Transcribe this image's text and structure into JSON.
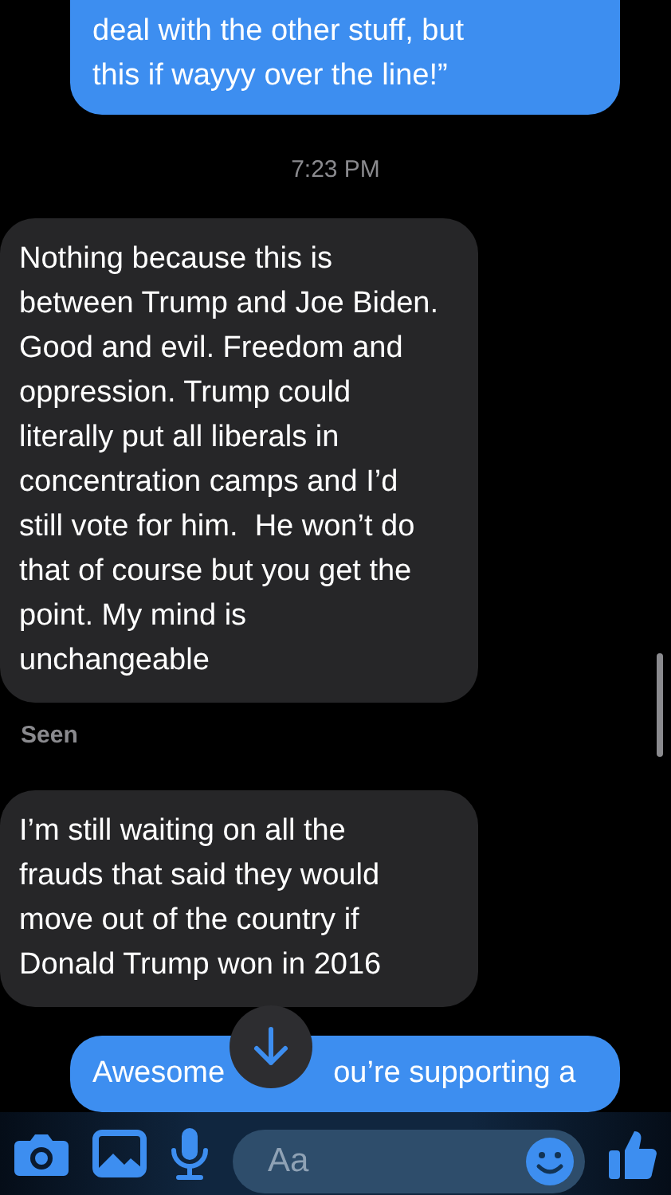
{
  "messages": [
    {
      "kind": "sent",
      "text": "deal with the other stuff, but\nthis if wayyy over the line!”"
    },
    {
      "kind": "time",
      "text": "7:23 PM"
    },
    {
      "kind": "received",
      "text": "Nothing because this is\nbetween Trump and Joe Biden.\nGood and evil. Freedom and\noppression. Trump could\nliterally put all liberals in\nconcentration camps and I’d\nstill vote for him.  He won’t do\nthat of course but you get the\npoint. My mind is\nunchangeable"
    },
    {
      "kind": "status",
      "text": "Seen"
    },
    {
      "kind": "received",
      "text": "I’m still waiting on all the\nfrauds that said they would\nmove out of the country if\nDonald Trump won in 2016"
    },
    {
      "kind": "sent_partly_covered",
      "parts": [
        "Awesome",
        "ou’re supporting a"
      ]
    }
  ],
  "composer": {
    "placeholder": "Aa"
  }
}
